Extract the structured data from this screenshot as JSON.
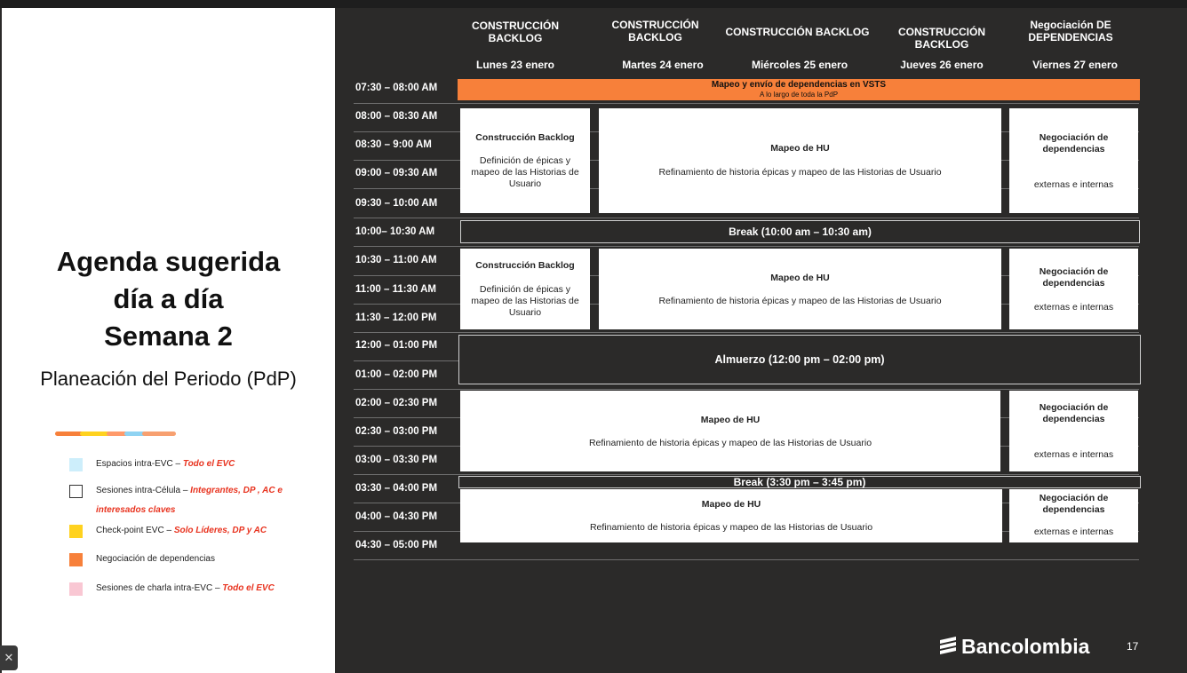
{
  "slide": {
    "title_lines": [
      "Agenda sugerida",
      "día a día",
      "Semana 2"
    ],
    "subtitle": "Planeación del Periodo (PdP)",
    "page_number": "17"
  },
  "legend": [
    {
      "label": "Espacios intra-EVC – ",
      "emph": "Todo el EVC",
      "color": "#cdeefb"
    },
    {
      "label": "Sesiones intra-Célula – ",
      "emph": "Integrantes, DP , AC e interesados claves",
      "color": "#ffffff"
    },
    {
      "label": "Check-point EVC – ",
      "emph": "Solo Líderes, DP y AC",
      "color": "#ffd21f"
    },
    {
      "label": "Negociación de dependencias",
      "emph": "",
      "color": "#f7803a"
    },
    {
      "label": "Sesiones de charla intra-EVC – ",
      "emph": "Todo el EVC",
      "color": "#f9c7d3"
    }
  ],
  "columns": [
    {
      "heading": "CONSTRUCCIÓN BACKLOG",
      "day": "Lunes 23 enero"
    },
    {
      "heading": "CONSTRUCCIÓN BACKLOG",
      "day": "Martes 24 enero"
    },
    {
      "heading": "CONSTRUCCIÓN BACKLOG",
      "day": "Miércoles 25 enero"
    },
    {
      "heading": "CONSTRUCCIÓN BACKLOG",
      "day": "Jueves 26 enero"
    },
    {
      "heading": "Negociación DE DEPENDENCIAS",
      "day": "Viernes 27 enero"
    }
  ],
  "times": [
    "07:30 – 08:00 AM",
    "08:00 – 08:30 AM",
    "08:30 – 9:00 AM",
    "09:00 – 09:30 AM",
    "09:30 – 10:00 AM",
    "10:00– 10:30 AM",
    "10:30 – 11:00 AM",
    "11:00 – 11:30 AM",
    "11:30 – 12:00 PM",
    "12:00 – 01:00 PM",
    "01:00 – 02:00 PM",
    "02:00 – 02:30 PM",
    "02:30 – 03:00 PM",
    "03:00 – 03:30 PM",
    "03:30 – 04:00 PM",
    "04:00 – 04:30 PM",
    "04:30 – 05:00 PM"
  ],
  "events": {
    "vsts": {
      "title": "Mapeo y envío de dependencias en VSTS",
      "note": "A lo largo de toda la PdP"
    },
    "backlog_title": "Construcción Backlog",
    "backlog_desc": "Definición de épicas y mapeo de las Historias de Usuario",
    "hu_title": "Mapeo de HU",
    "hu_desc": "Refinamiento de historia épicas y mapeo de las Historias de Usuario",
    "neg_title": "Negociación de dependencias",
    "neg_desc": "externas e internas",
    "break_am": "Break (10:00 am – 10:30 am)",
    "lunch": "Almuerzo (12:00 pm – 02:00 pm)",
    "break_pm": "Break (3:30 pm – 3:45 pm)"
  },
  "brand": "Bancolombia",
  "colors": {
    "background": "#2b2a29",
    "orange": "#f7803a",
    "accent_red": "#e8331f"
  }
}
